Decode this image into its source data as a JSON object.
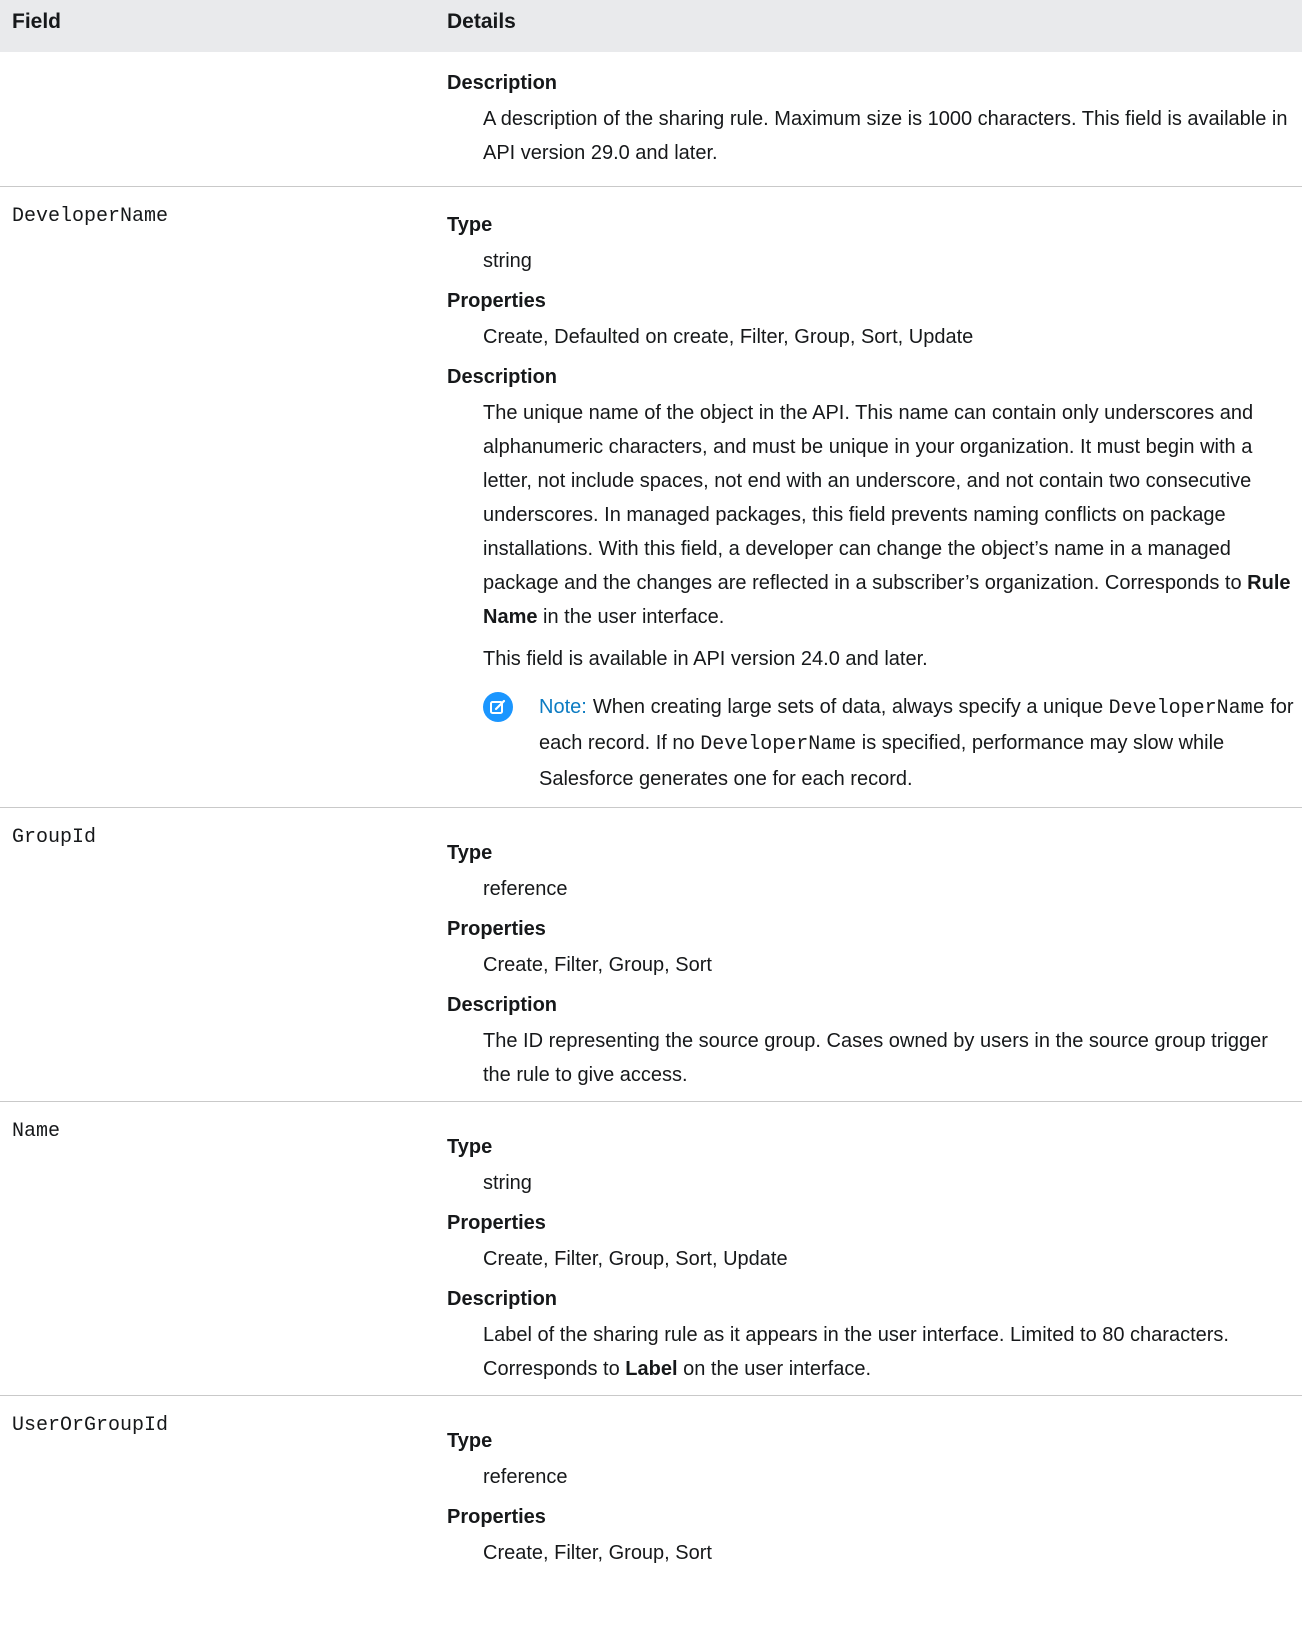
{
  "header": {
    "field": "Field",
    "details": "Details"
  },
  "rows": [
    {
      "field": "",
      "description_label": "Description",
      "description": "A description of the sharing rule. Maximum size is 1000 characters. This field is available in API version 29.0 and later."
    },
    {
      "field": "DeveloperName",
      "type_label": "Type",
      "type": "string",
      "properties_label": "Properties",
      "properties": "Create, Defaulted on create, Filter, Group, Sort, Update",
      "description_label": "Description",
      "description_pre": "The unique name of the object in the API. This name can contain only underscores and alphanumeric characters, and must be unique in your organization. It must begin with a letter, not include spaces, not end with an underscore, and not contain two consecutive underscores. In managed packages, this field prevents naming conflicts on package installations. With this field, a developer can change the object’s name in a managed package and the changes are reflected in a subscriber’s organization. Corresponds to ",
      "description_bold": "Rule Name",
      "description_post": " in the user interface.",
      "availability": "This field is available in API version 24.0 and later.",
      "note": {
        "label": "Note:",
        "text1": "When creating large sets of data, always specify a unique ",
        "code1": "DeveloperName",
        "text2": " for each record. If no ",
        "code2": "DeveloperName",
        "text3": " is specified, performance may slow while Salesforce generates one for each record."
      }
    },
    {
      "field": "GroupId",
      "type_label": "Type",
      "type": "reference",
      "properties_label": "Properties",
      "properties": "Create, Filter, Group, Sort",
      "description_label": "Description",
      "description": "The ID representing the source group. Cases owned by users in the source group trigger the rule to give access."
    },
    {
      "field": "Name",
      "type_label": "Type",
      "type": "string",
      "properties_label": "Properties",
      "properties": "Create, Filter, Group, Sort, Update",
      "description_label": "Description",
      "description_pre": "Label of the sharing rule as it appears in the user interface. Limited to 80 characters. Corresponds to ",
      "description_bold": "Label",
      "description_post": " on the user interface."
    },
    {
      "field": "UserOrGroupId",
      "type_label": "Type",
      "type": "reference",
      "properties_label": "Properties",
      "properties": "Create, Filter, Group, Sort"
    }
  ]
}
